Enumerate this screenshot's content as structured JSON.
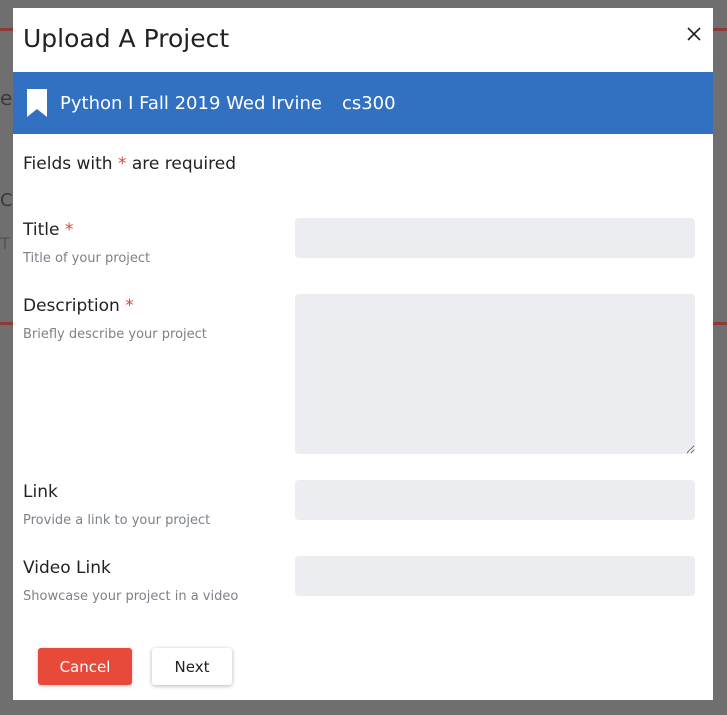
{
  "modal": {
    "title": "Upload A Project",
    "close_label": "×"
  },
  "banner": {
    "course": "Python I Fall 2019 Wed Irvine",
    "code": "cs300",
    "icon": "bookmark-icon",
    "color": "#3270c2"
  },
  "required_note": {
    "prefix": "Fields with",
    "star": "*",
    "suffix": "are required"
  },
  "fields": [
    {
      "label": "Title",
      "required_star": "*",
      "help": "Title of your project",
      "value": "",
      "placeholder": ""
    },
    {
      "label": "Description",
      "required_star": "*",
      "help": "Briefly describe your project",
      "value": "",
      "placeholder": ""
    },
    {
      "label": "Link",
      "help": "Provide a link to your project",
      "value": "",
      "placeholder": ""
    },
    {
      "label": "Video Link",
      "help": "Showcase your project in a video",
      "value": "",
      "placeholder": ""
    }
  ],
  "buttons": {
    "cancel": "Cancel",
    "next": "Next"
  },
  "colors": {
    "accent": "#3270c2",
    "danger": "#e84a3a",
    "required": "#e2403a"
  }
}
